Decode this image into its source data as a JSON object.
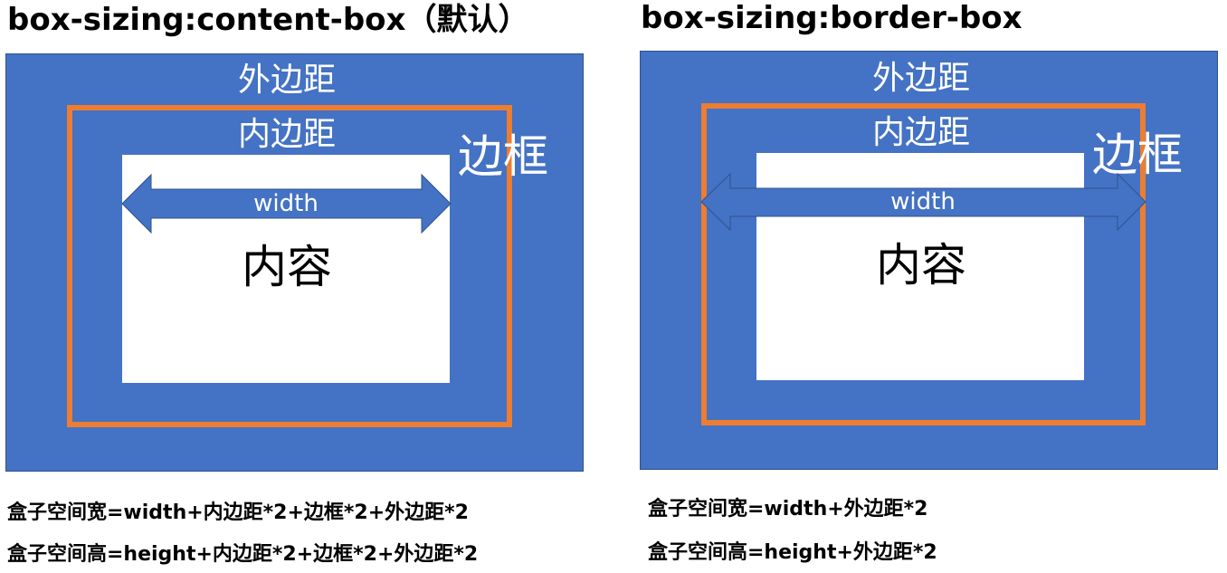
{
  "left": {
    "title": "box-sizing:content-box（默认）",
    "margin_label": "外边距",
    "padding_label": "内边距",
    "border_label": "边框",
    "width_label": "width",
    "content_label": "内容",
    "formula_width": "盒子空间宽=width+内边距*2+边框*2+外边距*2",
    "formula_height": "盒子空间高=height+内边距*2+边框*2+外边距*2"
  },
  "right": {
    "title": "box-sizing:border-box",
    "margin_label": "外边距",
    "padding_label": "内边距",
    "border_label": "边框",
    "width_label": "width",
    "content_label": "内容",
    "formula_width": "盒子空间宽=width+外边距*2",
    "formula_height": "盒子空间高=height+外边距*2"
  },
  "colors": {
    "margin_fill": "#4472c4",
    "border_stroke": "#ed7d31",
    "content_fill": "#ffffff",
    "arrow_fill": "#4472c4"
  }
}
